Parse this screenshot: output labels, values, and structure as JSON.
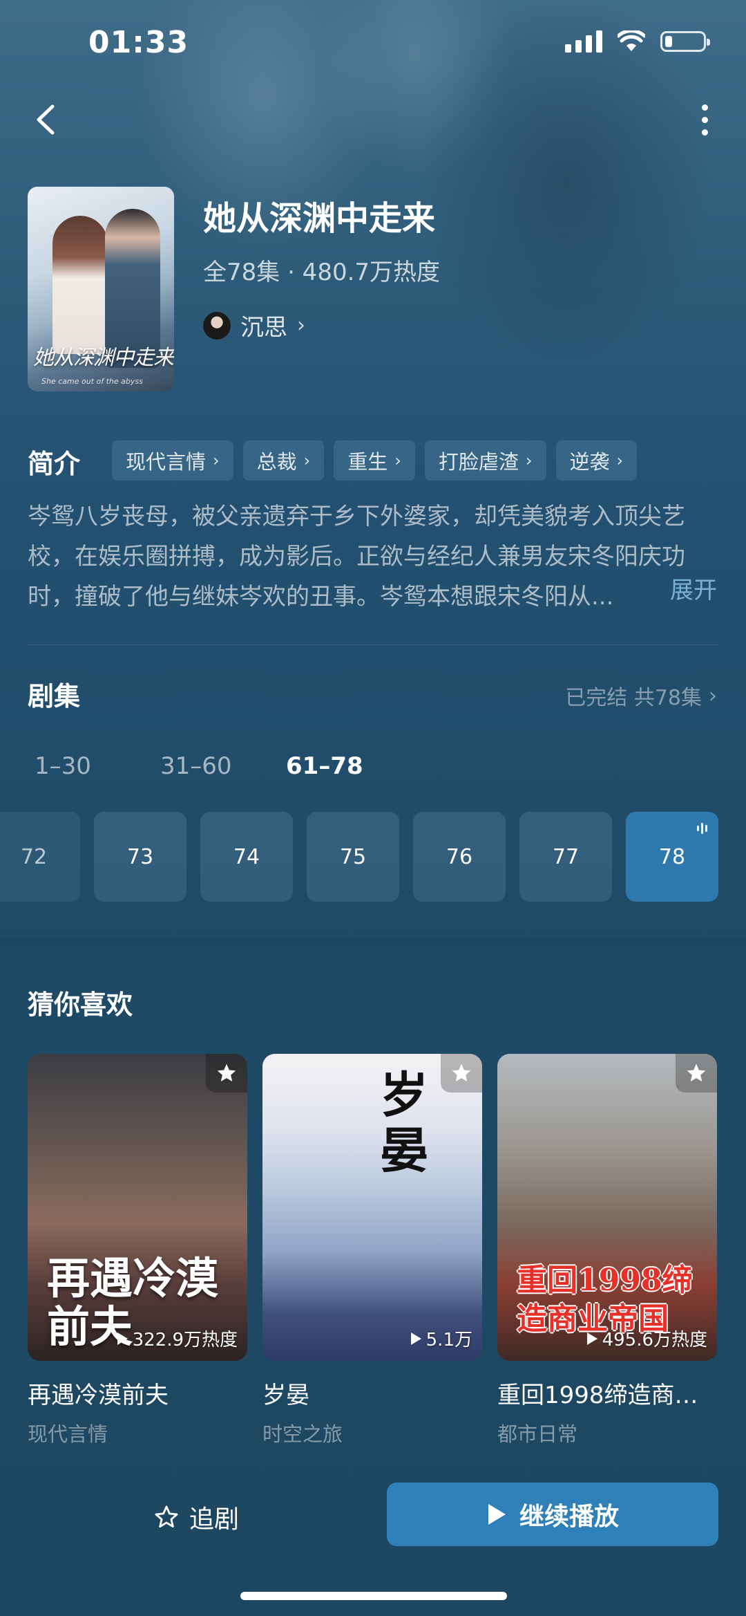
{
  "status_bar": {
    "time": "01:33",
    "battery_percent": 20
  },
  "drama": {
    "title": "她从深渊中走来",
    "meta": "全78集 · 480.7万热度",
    "author": "沉思",
    "poster_title": "她从深渊中走来",
    "poster_subtitle": "She came out of the abyss"
  },
  "intro": {
    "label": "简介",
    "tags": [
      "现代言情",
      "总裁",
      "重生",
      "打脸虐渣",
      "逆袭"
    ],
    "text": "岑鸳八岁丧母，被父亲遗弃于乡下外婆家，却凭美貌考入顶尖艺校，在娱乐圈拼搏，成为影后。正欲与经纪人兼男友宋冬阳庆功时，撞破了他与继妹岑欢的丑事。岑鸳本想跟宋冬阳从...",
    "expand": "展开"
  },
  "episodes": {
    "label": "剧集",
    "status": "已完结 共78集",
    "ranges": [
      "1–30",
      "31–60",
      "61–78"
    ],
    "active_range": 2,
    "items": [
      "72",
      "73",
      "74",
      "75",
      "76",
      "77",
      "78"
    ],
    "playing": "78"
  },
  "recommend": {
    "label": "猜你喜欢",
    "cards": [
      {
        "title": "再遇冷漠前夫",
        "tag": "现代言情",
        "heat": "322.9万热度",
        "cover_text": "再遇冷漠前夫"
      },
      {
        "title": "岁晏",
        "tag": "时空之旅",
        "heat": "5.1万",
        "cover_text": "岁晏"
      },
      {
        "title": "重回1998缔造商…",
        "tag": "都市日常",
        "heat": "495.6万热度",
        "cover_text": "重回1998缔造商业帝国"
      }
    ]
  },
  "bottom_bar": {
    "follow": "追剧",
    "play": "继续播放"
  },
  "colors": {
    "background": "#1f4a66",
    "accent": "#2f80b8",
    "link": "#7bb0d6"
  }
}
